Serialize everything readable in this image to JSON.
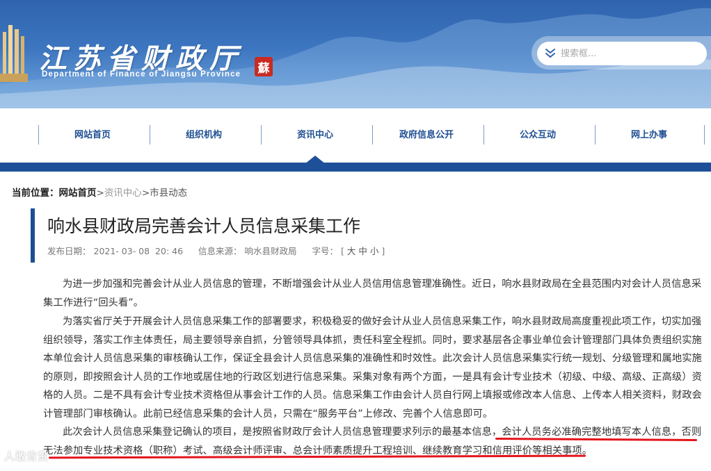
{
  "header": {
    "site_title": "江苏省财政厅",
    "site_subtitle": "Department of Finance of Jiangsu Province",
    "seal_char": "蘇",
    "search": {
      "placeholder": "搜索框..."
    }
  },
  "nav": {
    "items": [
      {
        "label": "网站首页"
      },
      {
        "label": "组织机构"
      },
      {
        "label": "资讯中心"
      },
      {
        "label": "政府信息公开"
      },
      {
        "label": "公众互动"
      },
      {
        "label": "网上办事"
      }
    ],
    "active_index": 2
  },
  "breadcrumb": {
    "label": "当前位置：",
    "home": "网站首页",
    "sep1": ">",
    "section": "资讯中心",
    "sep2": ">",
    "current": "市县动态"
  },
  "article": {
    "title": "响水县财政局完善会计人员信息采集工作",
    "meta": {
      "date_label": "发布日期：",
      "date": "2021- 03- 08  20: 46",
      "source_label": "信息来源：",
      "source": "响水县财政局",
      "font_label": "字号：",
      "font_open": "[",
      "size_large": "大",
      "size_medium": "中",
      "size_small": "小",
      "font_close": "]"
    },
    "paragraphs": [
      "为进一步加强和完善会计从业人员信息的管理，不断增强会计从业人员信用信息管理准确性。近日，响水县财政局在全县范围内对会计人员信息采集工作进行“回头看”。",
      "为落实省厅关于开展会计人员信息采集工作的部署要求，积极稳妥的做好会计从业人员信息采集工作，响水县财政局高度重视此项工作，切实加强组织领导，落实工作主体责任，局主要领导亲自抓，分管领导具体抓，责任科室全程抓。同时，要求基层各企事业单位会计管理部门具体负责组织实施本单位会计人员信息采集的审核确认工作，保证全县会计人员信息采集的准确性和时效性。此次会计人员信息采集实行统一规划、分级管理和属地实施的原则，即按照会计人员的工作地或居住地的行政区划进行信息采集。采集对象有两个方面，一是具有会计专业技术（初级、中级、高级、正高级）资格的人员。二是不具有会计专业技术资格但从事会计工作的人员。信息采集工作由会计人员自行网上填报或修改本人信息、上传本人相关资料，财政会计管理部门审核确认。此前已经信息采集的会计人员，只需在“服务平台”上修改、完善个人信息即可。",
      "此次会计人员信息采集登记确认的项目，是按照省财政厅会计人员信息管理要求列示的最基本信息，会计人员务必准确完整地填写本人信息，否则无法参加专业技术资格（职称）考试、高级会计师评审、总会计师素质提升工程培训、继续教育学习和信用评价等相关事项。"
    ]
  },
  "watermark": "人敢肯贯",
  "colors": {
    "brand_blue": "#1e5099",
    "nav_text": "#1f4f93",
    "underline_red": "#e4141c",
    "seal_red": "#c92a22"
  }
}
